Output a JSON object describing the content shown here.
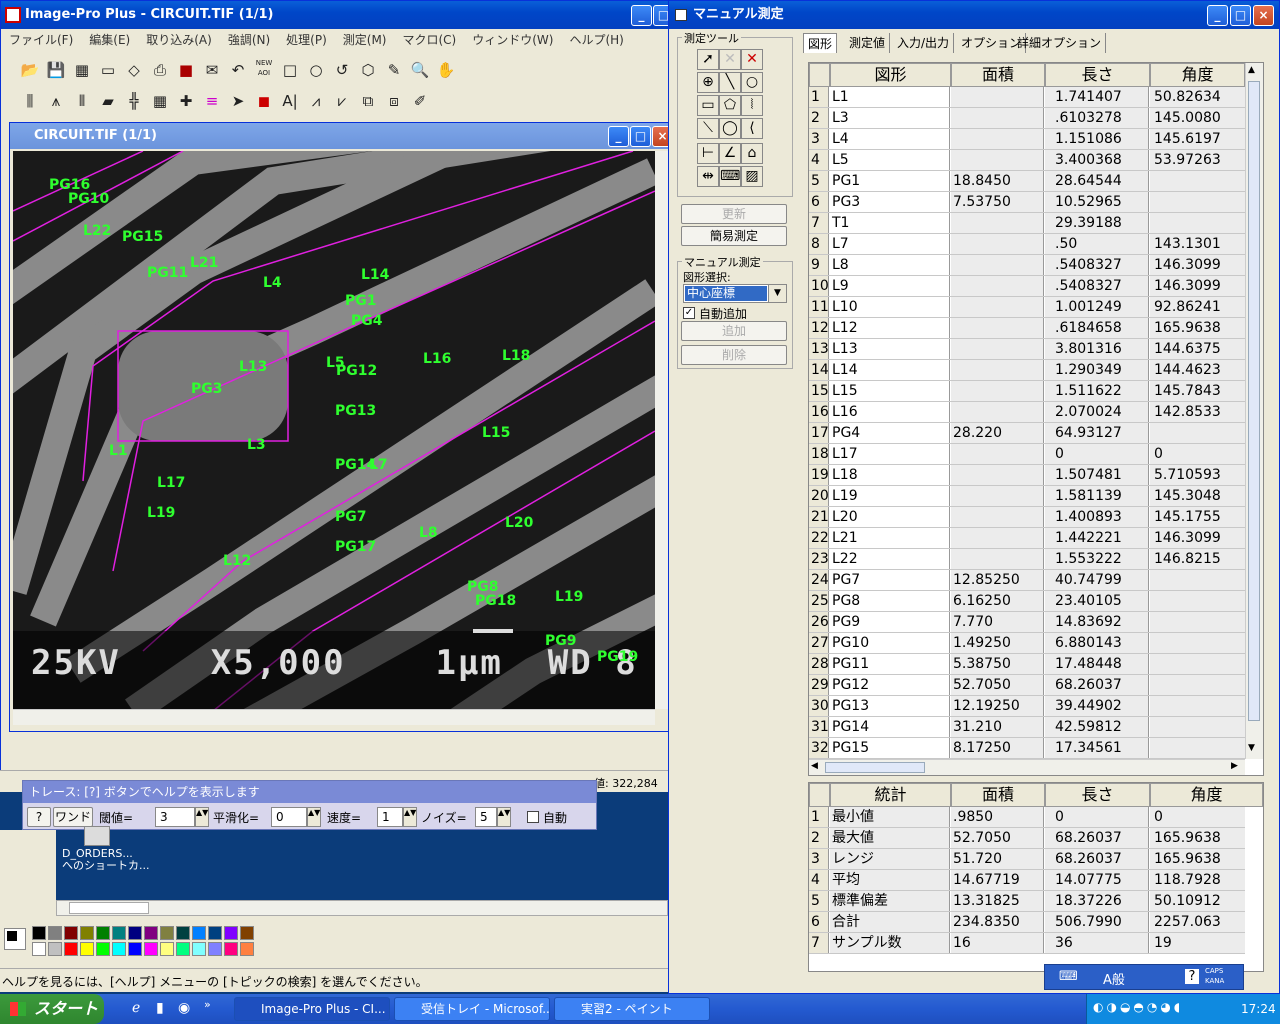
{
  "main_window": {
    "title": "Image-Pro Plus - CIRCUIT.TIF (1/1)",
    "menu": [
      "ファイル(F)",
      "編集(E)",
      "取り込み(A)",
      "強調(N)",
      "処理(P)",
      "測定(M)",
      "マクロ(C)",
      "ウィンドウ(W)",
      "ヘルプ(H)"
    ],
    "new_aoi": "NEW AOI"
  },
  "image_window": {
    "title": "CIRCUIT.TIF (1/1)",
    "info_bar": "25KV    X5,000    1μm  WD 8",
    "coords": "値: 322,284",
    "labels": [
      "PG16",
      "PG10",
      "L22",
      "PG15",
      "PG11",
      "L21",
      "L4",
      "L14",
      "PG1",
      "PG4",
      "L5",
      "PG12",
      "L16",
      "L18",
      "PG3",
      "L13",
      "PG13",
      "L15",
      "L1",
      "L3",
      "PG14",
      "L7",
      "L17",
      "L19",
      "PG7",
      "L8",
      "L20",
      "PG17",
      "L12",
      "PG8",
      "PG18",
      "L19",
      "PG9",
      "PG19"
    ]
  },
  "trace_bar": {
    "title": "トレース: [?] ボタンでヘルプを表示します",
    "help": "?",
    "wand": "ワンド",
    "threshold_label": "閾値=",
    "threshold_value": "3",
    "smooth_label": "平滑化=",
    "smooth_value": "0",
    "speed_label": "速度=",
    "speed_value": "1",
    "noise_label": "ノイズ=",
    "noise_value": "5",
    "auto_label": "自動"
  },
  "desktop": {
    "shortcut": "D_ORDERS...\nへのショートカ..."
  },
  "status_text": "ヘルプを見るには、[ヘルプ] メニューの [トピックの検索] を選んでください。",
  "manual": {
    "title": "マニュアル測定",
    "tools_group": "測定ツール",
    "update_btn": "更新",
    "simple_btn": "簡易測定",
    "manual_group": "マニュアル測定",
    "shape_select_label": "図形選択:",
    "shape_select_value": "中心座標",
    "auto_add_label": "自動追加",
    "add_btn": "追加",
    "delete_btn": "削除",
    "tabs": [
      "図形",
      "測定値",
      "入力/出力",
      "オプション",
      "詳細オプション"
    ],
    "headers": [
      "図形",
      "面積",
      "長さ",
      "角度"
    ],
    "rows": [
      [
        "1",
        "L1",
        "",
        "1.741407",
        "50.82634"
      ],
      [
        "2",
        "L3",
        "",
        ".6103278",
        "145.0080"
      ],
      [
        "3",
        "L4",
        "",
        "1.151086",
        "145.6197"
      ],
      [
        "4",
        "L5",
        "",
        "3.400368",
        "53.97263"
      ],
      [
        "5",
        "PG1",
        "18.8450",
        "28.64544",
        ""
      ],
      [
        "6",
        "PG3",
        "7.53750",
        "10.52965",
        ""
      ],
      [
        "7",
        "T1",
        "",
        "29.39188",
        ""
      ],
      [
        "8",
        "L7",
        "",
        ".50",
        "143.1301"
      ],
      [
        "9",
        "L8",
        "",
        ".5408327",
        "146.3099"
      ],
      [
        "10",
        "L9",
        "",
        ".5408327",
        "146.3099"
      ],
      [
        "11",
        "L10",
        "",
        "1.001249",
        "92.86241"
      ],
      [
        "12",
        "L12",
        "",
        ".6184658",
        "165.9638"
      ],
      [
        "13",
        "L13",
        "",
        "3.801316",
        "144.6375"
      ],
      [
        "14",
        "L14",
        "",
        "1.290349",
        "144.4623"
      ],
      [
        "15",
        "L15",
        "",
        "1.511622",
        "145.7843"
      ],
      [
        "16",
        "L16",
        "",
        "2.070024",
        "142.8533"
      ],
      [
        "17",
        "PG4",
        "28.220",
        "64.93127",
        ""
      ],
      [
        "18",
        "L17",
        "",
        "0",
        "0"
      ],
      [
        "19",
        "L18",
        "",
        "1.507481",
        "5.710593"
      ],
      [
        "20",
        "L19",
        "",
        "1.581139",
        "145.3048"
      ],
      [
        "21",
        "L20",
        "",
        "1.400893",
        "145.1755"
      ],
      [
        "22",
        "L21",
        "",
        "1.442221",
        "146.3099"
      ],
      [
        "23",
        "L22",
        "",
        "1.553222",
        "146.8215"
      ],
      [
        "24",
        "PG7",
        "12.85250",
        "40.74799",
        ""
      ],
      [
        "25",
        "PG8",
        "6.16250",
        "23.40105",
        ""
      ],
      [
        "26",
        "PG9",
        "7.770",
        "14.83692",
        ""
      ],
      [
        "27",
        "PG10",
        "1.49250",
        "6.880143",
        ""
      ],
      [
        "28",
        "PG11",
        "5.38750",
        "17.48448",
        ""
      ],
      [
        "29",
        "PG12",
        "52.7050",
        "68.26037",
        ""
      ],
      [
        "30",
        "PG13",
        "12.19250",
        "39.44902",
        ""
      ],
      [
        "31",
        "PG14",
        "31.210",
        "42.59812",
        ""
      ],
      [
        "32",
        "PG15",
        "8.17250",
        "17.34561",
        ""
      ]
    ],
    "stats_headers": [
      "統計",
      "面積",
      "長さ",
      "角度"
    ],
    "stats": [
      [
        "1",
        "最小値",
        ".9850",
        "0",
        "0"
      ],
      [
        "2",
        "最大値",
        "52.7050",
        "68.26037",
        "165.9638"
      ],
      [
        "3",
        "レンジ",
        "51.720",
        "68.26037",
        "165.9638"
      ],
      [
        "4",
        "平均",
        "14.67719",
        "14.07775",
        "118.7928"
      ],
      [
        "5",
        "標準偏差",
        "13.31825",
        "18.37226",
        "50.10912"
      ],
      [
        "6",
        "合計",
        "234.8350",
        "506.7990",
        "2257.063"
      ],
      [
        "7",
        "サンプル数",
        "16",
        "36",
        "19"
      ]
    ]
  },
  "taskbar": {
    "start": "スタート",
    "tasks": [
      "Image-Pro Plus - CI...",
      "受信トレイ - Microsof...",
      "実習2 - ペイント"
    ],
    "ime": "A般",
    "caps": "CAPS KANA",
    "clock": "17:24"
  }
}
